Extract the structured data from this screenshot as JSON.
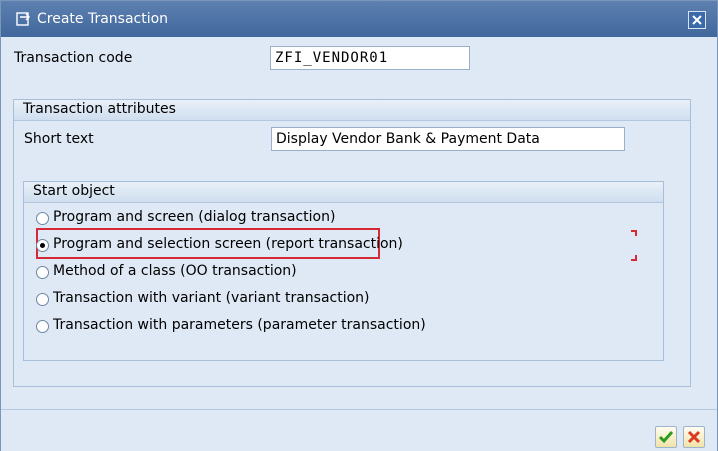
{
  "window": {
    "title": "Create Transaction"
  },
  "form": {
    "transaction_code_label": "Transaction code",
    "transaction_code_value": "ZFI_VENDOR01"
  },
  "attributes": {
    "group_title": "Transaction attributes",
    "short_text_label": "Short text",
    "short_text_value": "Display Vendor Bank & Payment Data"
  },
  "start_object": {
    "group_title": "Start object",
    "options": [
      {
        "label": "Program and screen (dialog transaction)",
        "selected": false
      },
      {
        "label": "Program and selection screen (report transaction)",
        "selected": true
      },
      {
        "label": "Method of a class (OO transaction)",
        "selected": false
      },
      {
        "label": "Transaction with variant (variant transaction)",
        "selected": false
      },
      {
        "label": "Transaction with parameters (parameter transaction)",
        "selected": false
      }
    ]
  },
  "colors": {
    "highlight": "#d42a35",
    "titlebar": "#4a6fa5",
    "panel": "#dfe9f5"
  }
}
